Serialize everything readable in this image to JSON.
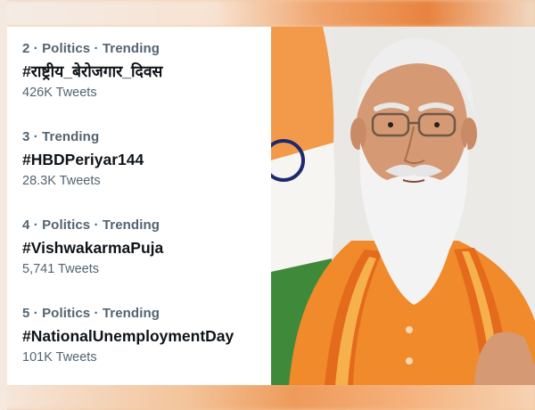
{
  "trends": [
    {
      "meta": "2 · Politics · Trending",
      "name": "#राष्ट्रीय_बेरोजगार_दिवस",
      "count": "426K Tweets"
    },
    {
      "meta": "3 · Trending",
      "name": "#HBDPeriyar144",
      "count": "28.3K Tweets"
    },
    {
      "meta": "4 · Politics · Trending",
      "name": "#VishwakarmaPuja",
      "count": "5,741 Tweets"
    },
    {
      "meta": "5 · Politics · Trending",
      "name": "#NationalUnemploymentDay",
      "count": "101K Tweets"
    }
  ],
  "colors": {
    "meta_text": "#536471",
    "name_text": "#0f1419",
    "panel_bg": "#ffffff",
    "saffron": "#f08a2a",
    "flag_orange": "#f39a4a",
    "flag_green": "#2e7d32",
    "chakra_navy": "#1e2a6e"
  }
}
